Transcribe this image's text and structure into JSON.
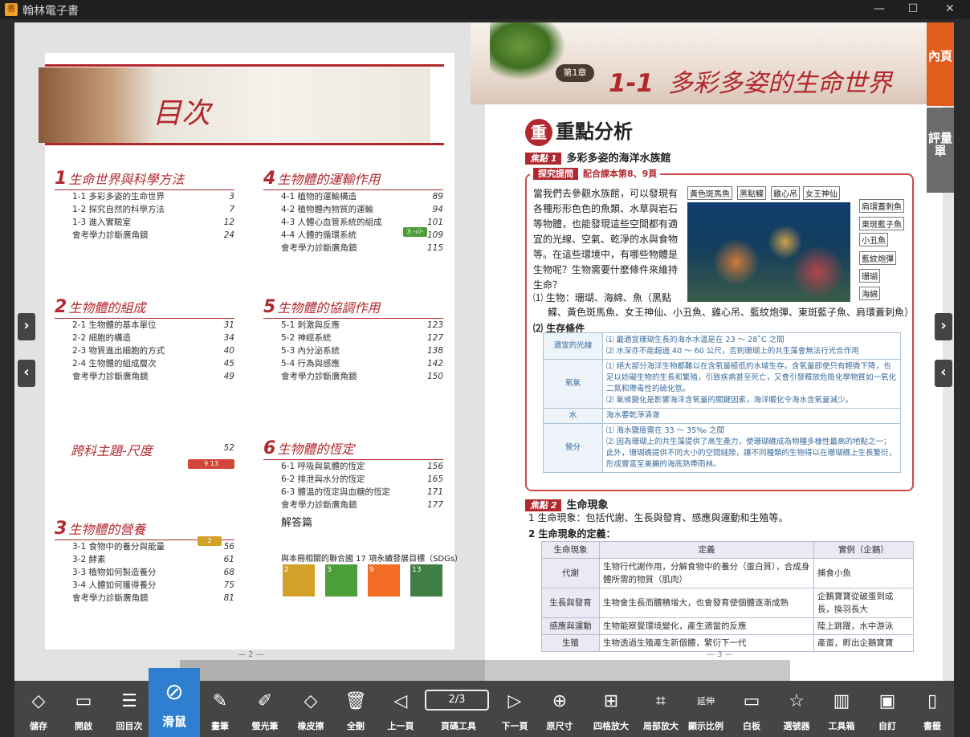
{
  "window": {
    "title": "翰林電子書",
    "app_icon": "書"
  },
  "window_controls": {
    "minimize": "—",
    "maximize": "☐",
    "close": "✕"
  },
  "side_tabs": [
    "內頁",
    "評量單"
  ],
  "nav_arrows": {
    "next": "›",
    "prev": "‹"
  },
  "left_page": {
    "toc_title": "目次",
    "chapters": [
      {
        "num": "1",
        "title": "生命世界與科學方法",
        "rows": [
          [
            "1-1  多彩多姿的生命世界",
            "3"
          ],
          [
            "1-2  探究自然的科學方法",
            "7"
          ],
          [
            "1-3  進入實驗室",
            "12"
          ],
          [
            "會考學力診斷廣角鏡",
            "24"
          ]
        ]
      },
      {
        "num": "2",
        "title": "生物體的組成",
        "rows": [
          [
            "2-1  生物體的基本單位",
            "31"
          ],
          [
            "2-2  細胞的構造",
            "34"
          ],
          [
            "2-3  物質進出細胞的方式",
            "40"
          ],
          [
            "2-4  生物體的組成層次",
            "45"
          ],
          [
            "會考學力診斷廣角鏡",
            "49"
          ]
        ]
      },
      {
        "num": "",
        "title": "跨科主題-尺度",
        "rows": []
      },
      {
        "num": "3",
        "title": "生物體的營養",
        "rows": [
          [
            "3-1  食物中的養分與能量",
            "56"
          ],
          [
            "3-2  酵素",
            "61"
          ],
          [
            "3-3  植物如何製造養分",
            "68"
          ],
          [
            "3-4  人體如何獲得養分",
            "75"
          ],
          [
            "會考學力診斷廣角鏡",
            "81"
          ]
        ]
      },
      {
        "num": "4",
        "title": "生物體的運輸作用",
        "rows": [
          [
            "4-1  植物的運輸構造",
            "89"
          ],
          [
            "4-2  植物體內物質的運輸",
            "94"
          ],
          [
            "4-3  人體心血管系統的組成",
            "101"
          ],
          [
            "4-4  人體的循環系統",
            "109"
          ],
          [
            "會考學力診斷廣角鏡",
            "115"
          ]
        ]
      },
      {
        "num": "5",
        "title": "生物體的協調作用",
        "rows": [
          [
            "5-1  刺激與反應",
            "123"
          ],
          [
            "5-2  神經系統",
            "127"
          ],
          [
            "5-3  內分泌系統",
            "138"
          ],
          [
            "5-4  行為與感應",
            "142"
          ],
          [
            "會考學力診斷廣角鏡",
            "150"
          ]
        ]
      },
      {
        "num": "6",
        "title": "生物體的恆定",
        "rows": [
          [
            "6-1  呼吸與氣體的恆定",
            "156"
          ],
          [
            "6-2  排泄與水分的恆定",
            "165"
          ],
          [
            "6-3  體溫的恆定與血糖的恆定",
            "171"
          ],
          [
            "會考學力診斷廣角鏡",
            "177"
          ]
        ]
      }
    ],
    "cross_topic_page": "52",
    "answers": "解答篇",
    "sdg_note": "與本冊相關的聯合國 17 項永續發展目標（SDGs）",
    "sdgs": [
      {
        "n": "2",
        "color": "#d3a029"
      },
      {
        "n": "3",
        "color": "#4c9f38"
      },
      {
        "n": "9",
        "color": "#f36d25"
      },
      {
        "n": "13",
        "color": "#3f7e44"
      }
    ],
    "sdg_mini": {
      "toc_44": "3 -√/-",
      "cross": "9  13",
      "toc_31": "2"
    },
    "page_number": "— 2 —"
  },
  "right_page": {
    "chapter_badge": "第1章",
    "chapter_num": "1-1",
    "chapter_title": "多彩多姿的生命世界",
    "section_title": "重點分析",
    "section_badge": "重",
    "focus1_tag": "焦點 1",
    "focus1": "多彩多姿的海洋水族館",
    "inquiry_tag": "探究提問",
    "inquiry_ref": "配合課本第8、9頁",
    "inquiry_text": "當我們去參觀水族館，可以發現有各種形形色色的魚類、水草與岩石等物體，也能發現這些空間都有適宜的光線、空氣、乾淨的水與食物等。在這些環境中，有哪些物體是生物呢？生物需要什麼條件來維持生命？",
    "fish_labels_top": [
      "黃色斑馬魚",
      "黑點鰈",
      "雞心吊",
      "女王神仙"
    ],
    "fish_labels_side": [
      "肩環蓋刺魚",
      "東斑藍子魚",
      "小丑魚",
      "藍紋炮彈",
      "珊瑚",
      "海綿"
    ],
    "bio_line1": "⑴ 生物：珊瑚、海綿、魚（黑點",
    "bio_line2": "鰈、黃色斑馬魚、女王神仙、小丑魚、雞心吊、藍紋炮彈、東斑藍子魚、肩環蓋刺魚）",
    "cond_label": "⑵ 生存條件",
    "conditions": [
      {
        "k": "適宜的光線",
        "v": "⑴ 最適宜珊瑚生長的海水水溫是在 23 ～ 28˚C 之間\n⑵ 水深亦不能超過 40 ～ 60 公尺，否則珊瑚上的共生藻會無法行光合作用"
      },
      {
        "k": "氧氣",
        "v": "⑴ 絕大部分海洋生物都難以在含氧量極低的水域生存。含氧量即使只有輕微下降，也足以妨礙生物的生長和繁殖，引致疾病甚至死亡，又會引發釋放危險化學物質如一氧化二氮和帶毒性的硫化氫。\n⑵ 氣候變化是影響海洋含氧量的關鍵因素，海洋暖化令海水含氧量減少。"
      },
      {
        "k": "水",
        "v": "海水要乾淨清澈"
      },
      {
        "k": "營分",
        "v": "⑴ 海水鹽度需在 33 ～ 35‰ 之間\n⑵ 因為珊瑚上的共生藻提供了高生產力，使珊瑚礁成為物種多樣性最高的地點之一；此外，珊瑚礁提供不同大小的空間縫隙，讓不同種類的生物得以在珊瑚礁上生長繁衍，形成豐富至美麗的海底熱帶雨林。"
      }
    ],
    "focus2_tag": "焦點 2",
    "focus2": "生命現象",
    "line1": "1  生命現象：包括代謝、生長與發育、感應與運動和生殖等。",
    "line2": "2  生命現象的定義：",
    "def_headers": [
      "生命現象",
      "定義",
      "實例（企鵝）"
    ],
    "def_rows": [
      [
        "代謝",
        "生物行代謝作用，分解食物中的養分（蛋白質），合成身體所需的物質（肌肉）",
        "捕食小魚"
      ],
      [
        "生長與發育",
        "生物會生長而體積增大，也會發育使個體逐漸成熟",
        "企鵝寶寶從破蛋到成長，換羽長大"
      ],
      [
        "感應與運動",
        "生物能察覺環境變化，產生適當的反應",
        "陸上跳躍，水中游泳"
      ],
      [
        "生殖",
        "生物透過生殖產生新個體，繁衍下一代",
        "產蛋，孵出企鵝寶寶"
      ]
    ],
    "page_number": "— 3 —"
  },
  "toolbar": {
    "page_field": "2/3",
    "tools": [
      {
        "icon": "◇",
        "label": "儲存"
      },
      {
        "icon": "▭",
        "label": "開啟"
      },
      {
        "icon": "☰",
        "label": "回目次"
      },
      {
        "icon": "✎",
        "label": "畫筆"
      },
      {
        "icon": "✐",
        "label": "螢光筆"
      },
      {
        "icon": "◇",
        "label": "橡皮擦"
      },
      {
        "icon": "🗑",
        "label": "全刪"
      },
      {
        "icon": "◁",
        "label": "上一頁"
      },
      {
        "icon": "",
        "label": "頁碼工具"
      },
      {
        "icon": "▷",
        "label": "下一頁"
      },
      {
        "icon": "⊕",
        "label": "原尺寸"
      },
      {
        "icon": "⊞",
        "label": "四格放大"
      },
      {
        "icon": "⌗",
        "label": "局部放大"
      },
      {
        "icon": "延伸",
        "label": "顯示比例"
      },
      {
        "icon": "▭",
        "label": "白板"
      },
      {
        "icon": "☆",
        "label": "選號器"
      },
      {
        "icon": "▥",
        "label": "工具箱"
      },
      {
        "icon": "▣",
        "label": "自訂"
      },
      {
        "icon": "▯",
        "label": "書籤"
      }
    ],
    "slide_icon": "⊘",
    "slide_label": "滑鼠"
  }
}
